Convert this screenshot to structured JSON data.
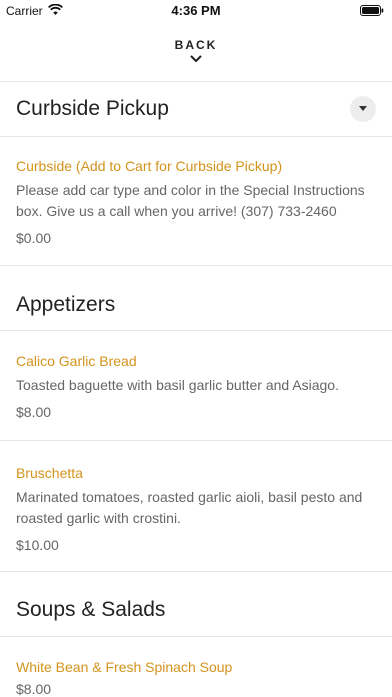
{
  "status_bar": {
    "carrier": "Carrier",
    "time": "4:36 PM"
  },
  "nav": {
    "back_label": "BACK"
  },
  "sections": [
    {
      "title": "Curbside Pickup",
      "items": [
        {
          "name": "Curbside (Add to Cart for Curbside Pickup)",
          "description": "Please add car type and color in the Special Instructions box. Give us a call when you arrive! (307) 733-2460",
          "price": "$0.00"
        }
      ]
    },
    {
      "title": "Appetizers",
      "items": [
        {
          "name": "Calico Garlic Bread",
          "description": "Toasted baguette with basil garlic butter and Asiago.",
          "price": "$8.00"
        },
        {
          "name": "Bruschetta",
          "description": "Marinated tomatoes, roasted garlic aioli, basil pesto and roasted garlic with crostini.",
          "price": "$10.00"
        }
      ]
    },
    {
      "title": "Soups & Salads",
      "items": [
        {
          "name": "White Bean & Fresh Spinach Soup",
          "price": "$8.00"
        }
      ]
    }
  ]
}
